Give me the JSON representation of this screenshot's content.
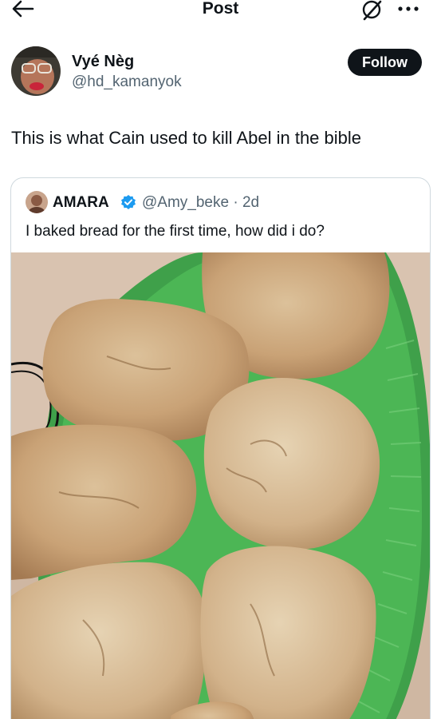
{
  "header": {
    "title": "Post",
    "back_icon": "arrow-left-icon",
    "grok_icon": "grok-icon",
    "more_icon": "more-horizontal-icon"
  },
  "author": {
    "display_name": "Vyé Nèg",
    "handle": "@hd_kamanyok",
    "avatar_icon": "avatar"
  },
  "follow": {
    "label": "Follow"
  },
  "post": {
    "text": "This is what Cain used to kill Abel in the bible"
  },
  "quote": {
    "display_name": "AMARA",
    "handle_time": "@Amy_beke · 2d",
    "verified_color": "#1d9bf0",
    "text": "I baked bread for the first time, how did i do?",
    "photo_icon": "bread-photo"
  },
  "colors": {
    "text": "#0f1419",
    "secondary": "#536471",
    "border": "#cfd9de",
    "button_bg": "#0f1419",
    "button_text": "#ffffff"
  }
}
